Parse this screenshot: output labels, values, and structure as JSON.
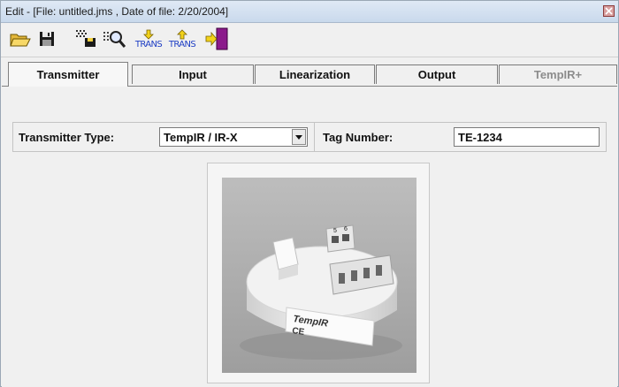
{
  "window": {
    "title": "Edit - [File: untitled.jms , Date of file: 2/20/2004]"
  },
  "toolbar": {
    "open_icon": "open-folder-icon",
    "save_icon": "floppy-disk-icon",
    "download_icon": "download-from-transmitter-icon",
    "search_icon": "magnify-icon",
    "trans_in_label": "TRANS",
    "trans_out_label": "TRANS",
    "exit_icon": "exit-door-icon"
  },
  "tabs": [
    {
      "label": "Transmitter",
      "active": true
    },
    {
      "label": "Input"
    },
    {
      "label": "Linearization"
    },
    {
      "label": "Output"
    },
    {
      "label": "TempIR+",
      "disabled": true
    }
  ],
  "form": {
    "transmitter_type_label": "Transmitter Type:",
    "transmitter_type_value": "TempIR / IR-X",
    "tag_number_label": "Tag Number:",
    "tag_number_value": "TE-1234"
  },
  "photo": {
    "brand_text": "TempIR",
    "ce_mark": "CE",
    "terminal_1": "5",
    "terminal_2": "6"
  },
  "colors": {
    "title_bar": "#c9d9ec",
    "window_bg": "#f0f0f0",
    "accent_blue": "#1f3fc4",
    "exit_door": "#8b1a8b"
  }
}
